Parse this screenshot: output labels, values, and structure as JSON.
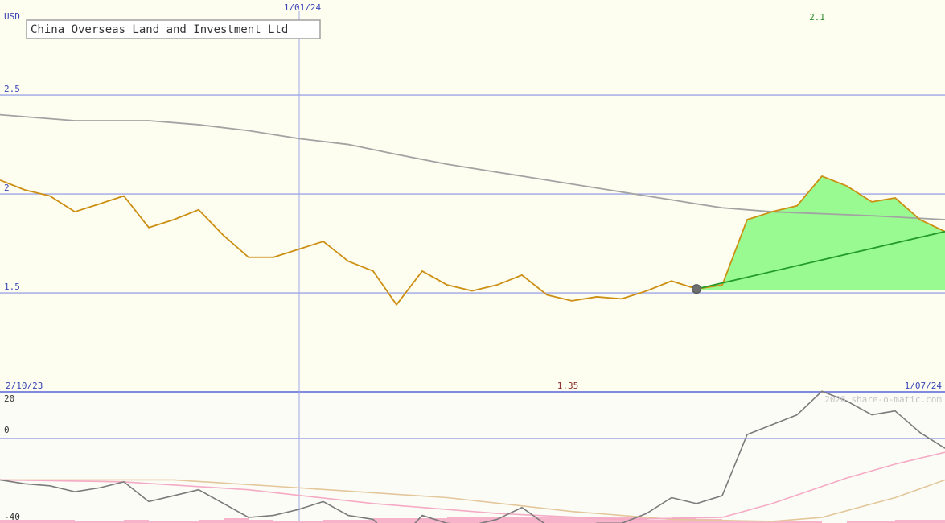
{
  "chart_data": {
    "type": "line",
    "title": "China Overseas Land and Investment Ltd",
    "currency_label": "USD",
    "x_start_label": "2/10/23",
    "x_end_label": "1/07/24",
    "x_mid_label": "1/01/24",
    "target_label": "2.1",
    "low_label": "1.35",
    "watermark": "2026 share-o-matic.com",
    "y_ticks": [
      "2.5",
      "2",
      "1.5"
    ],
    "ylim": [
      1.0,
      2.98
    ],
    "lower_ticks": [
      "20",
      "0",
      "-40"
    ],
    "lower_ylim": [
      -40,
      20
    ],
    "grid": true,
    "colors": {
      "background": "#fdfdf0",
      "lower_background": "#fbfcf6",
      "grid": "#9fa6e6",
      "axis_text": "#3a46b5",
      "price": "#cc8f12",
      "moving_average": "#a3a3a3",
      "forecast_fill": "#98fa90",
      "trend": "#239b2a",
      "target_text": "#2d8a2d",
      "low_text": "#8b2c2c",
      "watermark": "#c4c4c4",
      "osc_line": "#7b7b7b",
      "osc_pink": "#f5aac6",
      "osc_tan": "#e3c79b",
      "histogram": "#f7b3c9"
    },
    "series": [
      {
        "role": "price",
        "points": [
          [
            0,
            2.07
          ],
          [
            31,
            2.02
          ],
          [
            62,
            1.99
          ],
          [
            93,
            1.91
          ],
          [
            124,
            1.95
          ],
          [
            154,
            1.99
          ],
          [
            185,
            1.83
          ],
          [
            216,
            1.87
          ],
          [
            247,
            1.92
          ],
          [
            278,
            1.79
          ],
          [
            309,
            1.68
          ],
          [
            340,
            1.68
          ],
          [
            371,
            1.72
          ],
          [
            402,
            1.76
          ],
          [
            433,
            1.66
          ],
          [
            464,
            1.61
          ],
          [
            493,
            1.44
          ],
          [
            525,
            1.61
          ],
          [
            556,
            1.54
          ],
          [
            587,
            1.51
          ],
          [
            618,
            1.54
          ],
          [
            649,
            1.59
          ],
          [
            680,
            1.49
          ],
          [
            711,
            1.46
          ],
          [
            742,
            1.48
          ],
          [
            773,
            1.47
          ],
          [
            804,
            1.51
          ],
          [
            835,
            1.56
          ],
          [
            866,
            1.52
          ]
        ]
      },
      {
        "role": "moving_average",
        "points": [
          [
            0,
            2.4
          ],
          [
            93,
            2.37
          ],
          [
            185,
            2.37
          ],
          [
            247,
            2.35
          ],
          [
            309,
            2.32
          ],
          [
            371,
            2.28
          ],
          [
            433,
            2.25
          ],
          [
            493,
            2.2
          ],
          [
            556,
            2.15
          ],
          [
            618,
            2.11
          ],
          [
            649,
            2.09
          ],
          [
            711,
            2.05
          ],
          [
            773,
            2.01
          ],
          [
            835,
            1.97
          ],
          [
            866,
            1.95
          ],
          [
            898,
            1.93
          ],
          [
            960,
            1.91
          ],
          [
            1022,
            1.9
          ],
          [
            1084,
            1.89
          ],
          [
            1175,
            1.87
          ]
        ]
      },
      {
        "role": "forecast_upper",
        "points": [
          [
            866,
            1.52
          ],
          [
            898,
            1.54
          ],
          [
            929,
            1.87
          ],
          [
            960,
            1.91
          ],
          [
            991,
            1.94
          ],
          [
            1022,
            2.09
          ],
          [
            1053,
            2.04
          ],
          [
            1084,
            1.96
          ],
          [
            1113,
            1.98
          ],
          [
            1144,
            1.87
          ],
          [
            1175,
            1.81
          ]
        ]
      },
      {
        "role": "trend",
        "points": [
          [
            866,
            1.52
          ],
          [
            1175,
            1.81
          ]
        ]
      }
    ],
    "lower_series": [
      {
        "role": "oscillator",
        "points": [
          [
            0,
            -21
          ],
          [
            31,
            -23
          ],
          [
            62,
            -24
          ],
          [
            93,
            -27
          ],
          [
            124,
            -25
          ],
          [
            154,
            -22
          ],
          [
            185,
            -32
          ],
          [
            216,
            -29
          ],
          [
            247,
            -26
          ],
          [
            278,
            -33
          ],
          [
            309,
            -40
          ],
          [
            340,
            -39
          ],
          [
            371,
            -36
          ],
          [
            402,
            -32
          ],
          [
            433,
            -39
          ],
          [
            464,
            -41
          ],
          [
            493,
            -53
          ],
          [
            525,
            -39
          ],
          [
            556,
            -43
          ],
          [
            587,
            -44
          ],
          [
            618,
            -41
          ],
          [
            649,
            -35
          ],
          [
            680,
            -44
          ],
          [
            711,
            -46
          ],
          [
            742,
            -43
          ],
          [
            773,
            -43
          ],
          [
            804,
            -38
          ],
          [
            835,
            -30
          ],
          [
            866,
            -33
          ],
          [
            898,
            -29
          ],
          [
            929,
            2
          ],
          [
            960,
            7
          ],
          [
            991,
            12
          ],
          [
            1022,
            24
          ],
          [
            1053,
            19
          ],
          [
            1084,
            12
          ],
          [
            1113,
            14
          ],
          [
            1144,
            3
          ],
          [
            1175,
            -5
          ]
        ]
      },
      {
        "role": "signal_pink",
        "points": [
          [
            0,
            -21
          ],
          [
            154,
            -22
          ],
          [
            309,
            -26
          ],
          [
            464,
            -33
          ],
          [
            618,
            -38
          ],
          [
            773,
            -41
          ],
          [
            898,
            -40
          ],
          [
            960,
            -33
          ],
          [
            1053,
            -20
          ],
          [
            1113,
            -13
          ],
          [
            1175,
            -7
          ]
        ]
      },
      {
        "role": "signal_tan",
        "points": [
          [
            0,
            -21
          ],
          [
            216,
            -21
          ],
          [
            371,
            -25
          ],
          [
            556,
            -30
          ],
          [
            711,
            -37
          ],
          [
            835,
            -41
          ],
          [
            960,
            -42
          ],
          [
            1022,
            -40
          ],
          [
            1113,
            -30
          ],
          [
            1175,
            -21
          ]
        ]
      }
    ],
    "histogram": [
      [
        0,
        93,
        3
      ],
      [
        93,
        154,
        1
      ],
      [
        154,
        185,
        3
      ],
      [
        185,
        247,
        2
      ],
      [
        247,
        278,
        3
      ],
      [
        278,
        309,
        5
      ],
      [
        309,
        340,
        3
      ],
      [
        340,
        371,
        2
      ],
      [
        371,
        402,
        1
      ],
      [
        402,
        464,
        3
      ],
      [
        464,
        556,
        5
      ],
      [
        556,
        649,
        6
      ],
      [
        649,
        804,
        6
      ],
      [
        804,
        835,
        3
      ],
      [
        835,
        866,
        6
      ],
      [
        866,
        898,
        4
      ],
      [
        898,
        929,
        2
      ],
      [
        929,
        991,
        2
      ],
      [
        991,
        1022,
        1
      ],
      [
        1053,
        1113,
        2
      ],
      [
        1113,
        1175,
        3
      ]
    ]
  }
}
